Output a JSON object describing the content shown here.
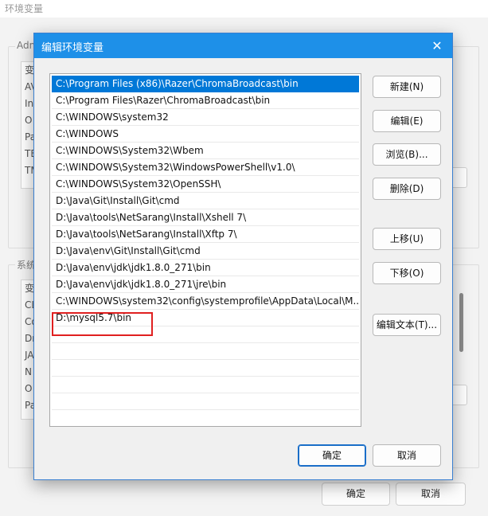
{
  "background_window": {
    "title": "环境变量",
    "user_group_label": "Adm",
    "user_rows": [
      "变",
      "AV",
      "In",
      "O",
      "Pa",
      "TE",
      "TM"
    ],
    "system_group_label": "系统",
    "system_rows": [
      "变",
      "CL",
      "Co",
      "Dr",
      "JA",
      "N",
      "O",
      "Pa"
    ],
    "ok_label": "确定",
    "cancel_label": "取消"
  },
  "dialog": {
    "title": "编辑环境变量",
    "close_glyph": "✕",
    "selected_index": 0,
    "highlighted_index": 14,
    "paths": [
      "C:\\Program Files (x86)\\Razer\\ChromaBroadcast\\bin",
      "C:\\Program Files\\Razer\\ChromaBroadcast\\bin",
      "C:\\WINDOWS\\system32",
      "C:\\WINDOWS",
      "C:\\WINDOWS\\System32\\Wbem",
      "C:\\WINDOWS\\System32\\WindowsPowerShell\\v1.0\\",
      "C:\\WINDOWS\\System32\\OpenSSH\\",
      "D:\\Java\\Git\\Install\\Git\\cmd",
      "D:\\Java\\tools\\NetSarang\\Install\\Xshell 7\\",
      "D:\\Java\\tools\\NetSarang\\Install\\Xftp 7\\",
      "D:\\Java\\env\\Git\\Install\\Git\\cmd",
      "D:\\Java\\env\\jdk\\jdk1.8.0_271\\bin",
      "D:\\Java\\env\\jdk\\jdk1.8.0_271\\jre\\bin",
      "C:\\WINDOWS\\system32\\config\\systemprofile\\AppData\\Local\\M...",
      "D:\\mysql5.7\\bin"
    ],
    "buttons": {
      "new": "新建(N)",
      "edit": "编辑(E)",
      "browse": "浏览(B)...",
      "delete": "删除(D)",
      "move_up": "上移(U)",
      "move_down": "下移(O)",
      "edit_text": "编辑文本(T)...",
      "ok": "确定",
      "cancel": "取消"
    }
  },
  "colors": {
    "title_bar": "#1e90e8",
    "selection": "#0078d7",
    "highlight_box": "#e02020"
  }
}
